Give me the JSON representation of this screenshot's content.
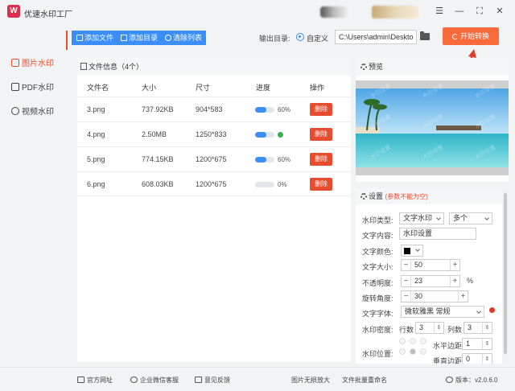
{
  "app": {
    "title": "优速水印工厂",
    "logo_char": "W"
  },
  "window": {
    "menu_glyph": "☰",
    "minimize_glyph": "—",
    "maximize_glyph": "⛶",
    "close_glyph": "✕"
  },
  "sidebar": {
    "items": [
      {
        "label": "图片水印",
        "active": true
      },
      {
        "label": "PDF水印",
        "active": false
      },
      {
        "label": "视频水印",
        "active": false
      }
    ]
  },
  "toolbar": {
    "add_file": "添加文件",
    "add_dir": "添加目录",
    "clear_list": "清除列表",
    "output_label": "输出目录:",
    "custom_label": "自定义",
    "output_path": "C:\\Users\\admin\\Deskto",
    "start_button": "开始转换"
  },
  "file_panel": {
    "header": "文件信息（4个）",
    "columns": [
      "文件名",
      "大小",
      "尺寸",
      "进度",
      "操作"
    ],
    "delete_label": "删除",
    "rows": [
      {
        "name": "3.png",
        "size": "737.92KB",
        "dims": "904*583",
        "progress": 60,
        "progress_text": "60%",
        "done": false
      },
      {
        "name": "4.png",
        "size": "2.50MB",
        "dims": "1250*833",
        "progress": 60,
        "progress_text": "",
        "done": true
      },
      {
        "name": "5.png",
        "size": "774.15KB",
        "dims": "1200*675",
        "progress": 60,
        "progress_text": "60%",
        "done": false
      },
      {
        "name": "6.png",
        "size": "608.03KB",
        "dims": "1200*675",
        "progress": 0,
        "progress_text": "0%",
        "done": false
      }
    ]
  },
  "preview": {
    "title": "预览",
    "watermark_text": "水印设置"
  },
  "settings": {
    "title": "设置",
    "warning": "(参数不能为空)",
    "type_label": "水印类型:",
    "type_value": "文字水印",
    "layout_value": "多个",
    "content_label": "文字内容:",
    "content_value": "水印设置",
    "color_label": "文字颜色:",
    "size_label": "文字大小:",
    "size_value": "50",
    "opacity_label": "不透明度:",
    "opacity_value": "23",
    "opacity_unit": "%",
    "rotation_label": "旋转角度:",
    "rotation_value": "30",
    "font_label": "文字字体:",
    "font_value": "微软雅黑 常规",
    "density_label": "水印密度:",
    "rows_label": "行数",
    "rows_value": "3",
    "cols_label": "列数",
    "cols_value": "3",
    "position_label": "水印位置:",
    "h_margin_label": "水平边距",
    "h_margin_value": "1",
    "v_margin_label": "垂直边距",
    "v_margin_value": "0",
    "stepper_minus": "−",
    "stepper_plus": "+"
  },
  "footer": {
    "official_site": "官方网址",
    "wechat_service": "企业微信客服",
    "feedback": "意见反馈",
    "link1": "图片无损放大",
    "link2": "文件批量重命名",
    "version_label": "版本：",
    "version": "v2.0.6.0"
  },
  "colors": {
    "accent": "#3a8ef6",
    "start": "#fa6a3a",
    "danger": "#e54d2e",
    "active_nav": "#e8502d"
  }
}
